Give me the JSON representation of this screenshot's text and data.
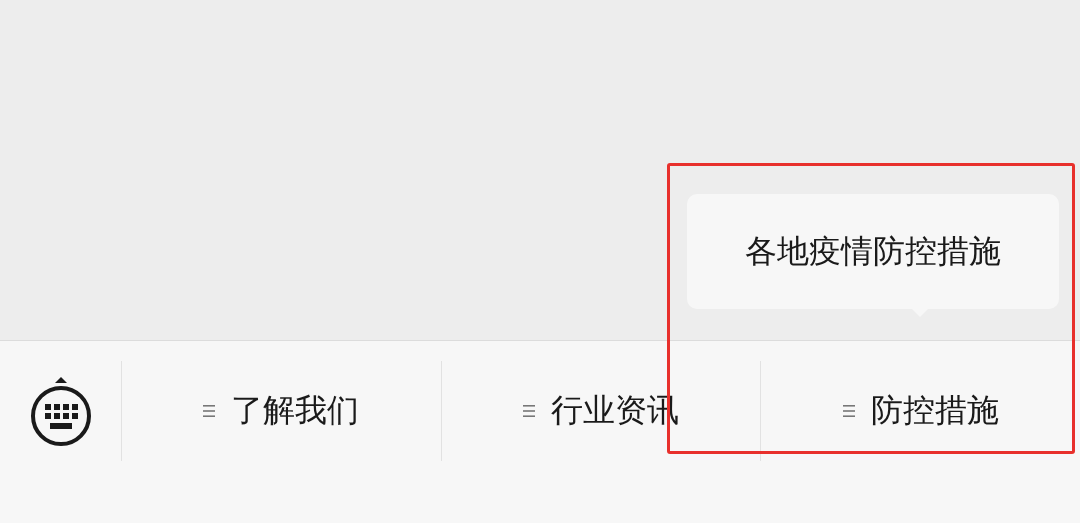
{
  "menu_bar": {
    "items": [
      {
        "label": "了解我们"
      },
      {
        "label": "行业资讯"
      },
      {
        "label": "防控措施",
        "submenu": [
          "各地疫情防控措施"
        ]
      }
    ]
  },
  "annotation": {
    "kind": "highlight-box"
  }
}
